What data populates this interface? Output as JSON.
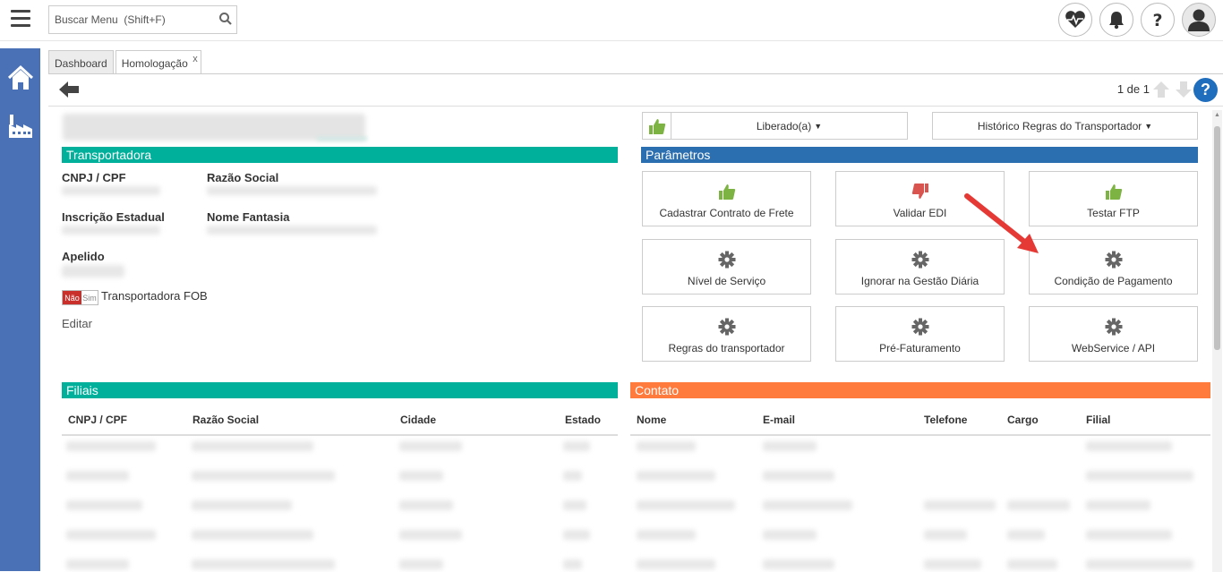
{
  "topbar": {
    "search_placeholder": "Buscar Menu  (Shift+F)"
  },
  "tabs": [
    {
      "label": "Dashboard"
    },
    {
      "label": "Homologação",
      "close": "x"
    }
  ],
  "toolbar": {
    "pager": "1 de 1",
    "help": "?"
  },
  "transportadora": {
    "title": "Transportadora",
    "cnpj_label": "CNPJ / CPF",
    "razao_label": "Razão Social",
    "ie_label": "Inscrição Estadual",
    "fantasia_label": "Nome Fantasia",
    "apelido_label": "Apelido",
    "toggle_no": "Não",
    "toggle_yes": "Sim",
    "fob_label": "Transportadora FOB",
    "edit_label": "Editar"
  },
  "status": {
    "liberado": "Liberado(a)",
    "historico": "Histórico Regras do Transportador"
  },
  "parametros": {
    "title": "Parâmetros",
    "items": [
      {
        "label": "Cadastrar Contrato de Frete",
        "icon": "thumbs-up-icon",
        "color": "#7cb342"
      },
      {
        "label": "Validar EDI",
        "icon": "thumbs-down-icon",
        "color": "#d9534f"
      },
      {
        "label": "Testar FTP",
        "icon": "thumbs-up-icon",
        "color": "#7cb342"
      },
      {
        "label": "Nível de Serviço",
        "icon": "gear-icon"
      },
      {
        "label": "Ignorar na Gestão Diária",
        "icon": "gear-icon"
      },
      {
        "label": "Condição de Pagamento",
        "icon": "gear-icon"
      },
      {
        "label": "Regras do transportador",
        "icon": "gear-icon"
      },
      {
        "label": "Pré-Faturamento",
        "icon": "gear-icon"
      },
      {
        "label": "WebService / API",
        "icon": "gear-icon"
      }
    ]
  },
  "filiais": {
    "title": "Filiais",
    "columns": [
      "CNPJ / CPF",
      "Razão Social",
      "Cidade",
      "Estado"
    ]
  },
  "contato": {
    "title": "Contato",
    "columns": [
      "Nome",
      "E-mail",
      "Telefone",
      "Cargo",
      "Filial"
    ]
  },
  "colors": {
    "teal": "#00b09b",
    "blue": "#2c6fb0",
    "orange": "#ff7a3d",
    "sidebar": "#4a70b6",
    "green": "#7cb342",
    "red": "#d9534f"
  }
}
